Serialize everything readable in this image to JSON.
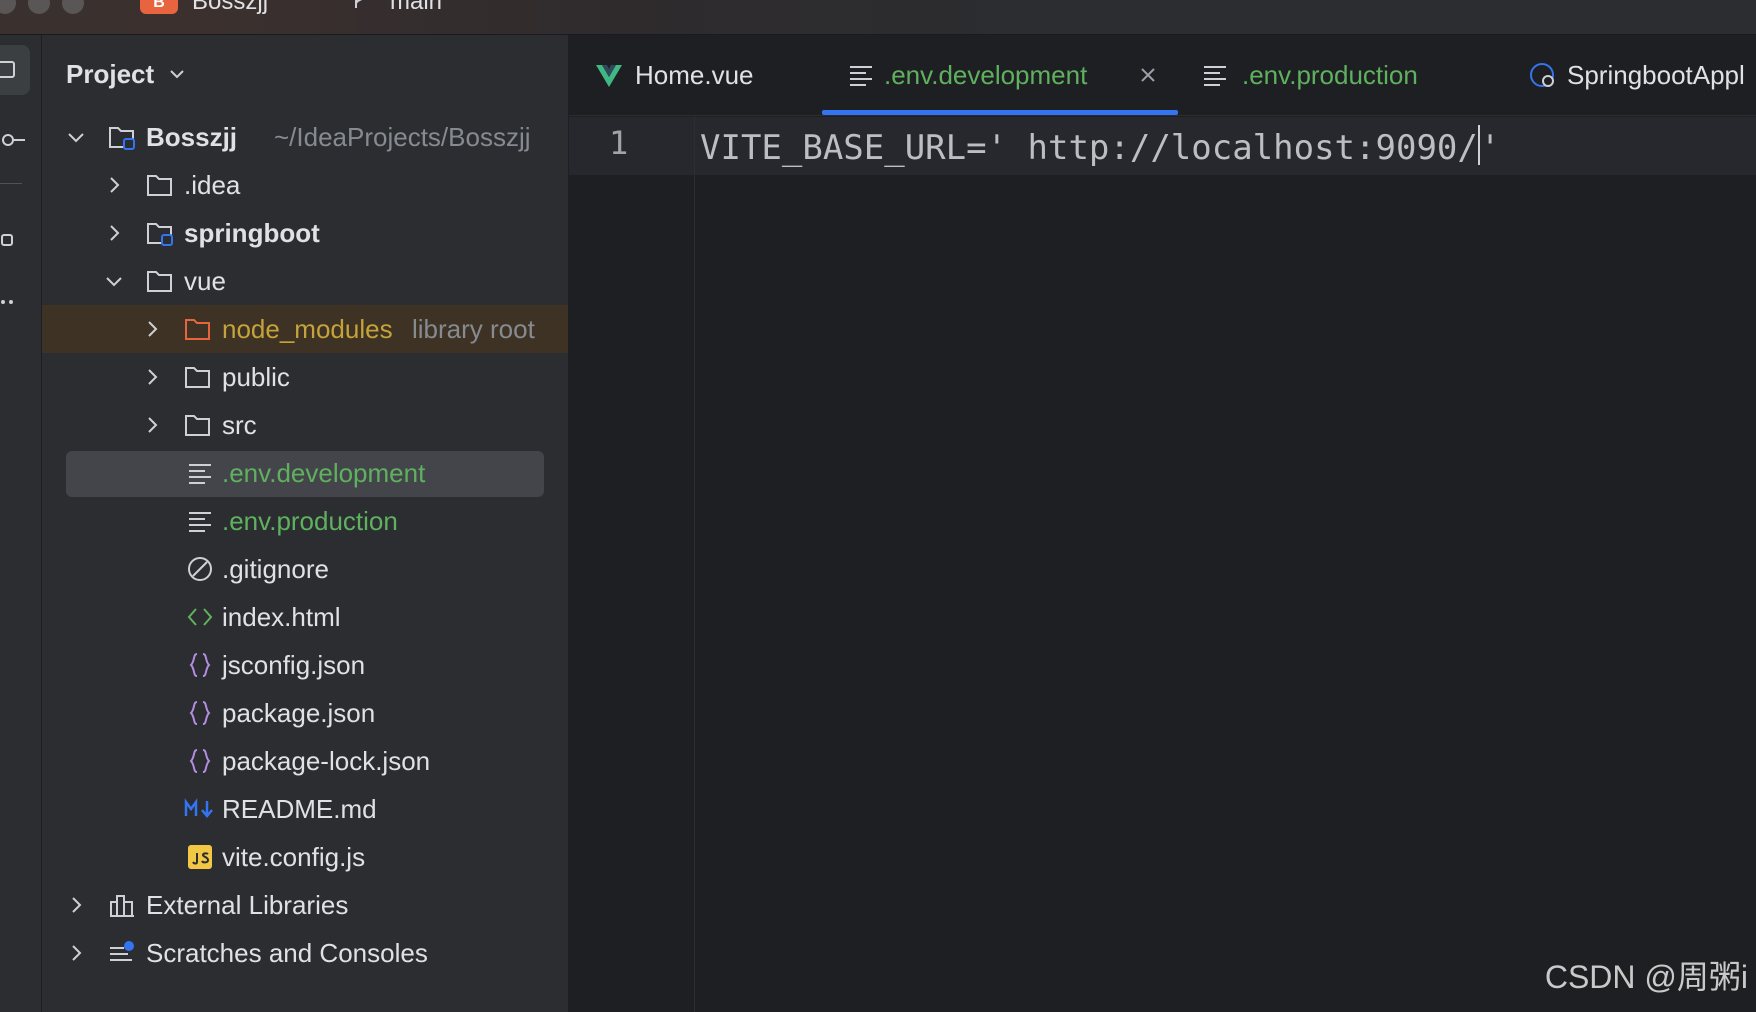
{
  "titlebar": {
    "project_badge": "B",
    "project_name": "Bosszjj",
    "branch": "main"
  },
  "project_panel": {
    "title": "Project",
    "tree": [
      {
        "label": "Bosszjj",
        "sub": "~/IdeaProjects/Bosszjj",
        "icon": "module-folder-icon",
        "expanded": true
      },
      {
        "label": ".idea",
        "icon": "folder-icon",
        "expanded": false
      },
      {
        "label": "springboot",
        "icon": "module-folder-icon",
        "expanded": false
      },
      {
        "label": "vue",
        "icon": "folder-icon",
        "expanded": true
      },
      {
        "label": "node_modules",
        "sub": "library root",
        "icon": "excluded-folder-icon",
        "expanded": false
      },
      {
        "label": "public",
        "icon": "folder-icon",
        "expanded": false
      },
      {
        "label": "src",
        "icon": "folder-icon",
        "expanded": false
      },
      {
        "label": ".env.development",
        "icon": "text-file-icon",
        "selected": true
      },
      {
        "label": ".env.production",
        "icon": "text-file-icon"
      },
      {
        "label": ".gitignore",
        "icon": "ignore-file-icon"
      },
      {
        "label": "index.html",
        "icon": "html-file-icon"
      },
      {
        "label": "jsconfig.json",
        "icon": "json-file-icon"
      },
      {
        "label": "package.json",
        "icon": "json-file-icon"
      },
      {
        "label": "package-lock.json",
        "icon": "json-file-icon"
      },
      {
        "label": "README.md",
        "icon": "markdown-file-icon"
      },
      {
        "label": "vite.config.js",
        "icon": "js-file-icon"
      },
      {
        "label": "External Libraries",
        "icon": "library-icon",
        "expanded": false
      },
      {
        "label": "Scratches and Consoles",
        "icon": "scratches-icon",
        "expanded": false
      }
    ]
  },
  "editor": {
    "tabs": [
      {
        "label": "Home.vue",
        "icon": "vue-icon"
      },
      {
        "label": ".env.development",
        "icon": "text-file-icon",
        "active": true
      },
      {
        "label": ".env.production",
        "icon": "text-file-icon"
      },
      {
        "label": "SpringbootAppl",
        "icon": "spring-boot-icon"
      }
    ],
    "line_number": "1",
    "code_line": "VITE_BASE_URL=' http://localhost:9090/",
    "code_tail": "'"
  },
  "watermark": "CSDN @周粥i",
  "colors": {
    "accent": "#3574f0",
    "modified_green": "#5fb15f",
    "library_amber": "#c4a43a",
    "selection": "#43454a"
  }
}
